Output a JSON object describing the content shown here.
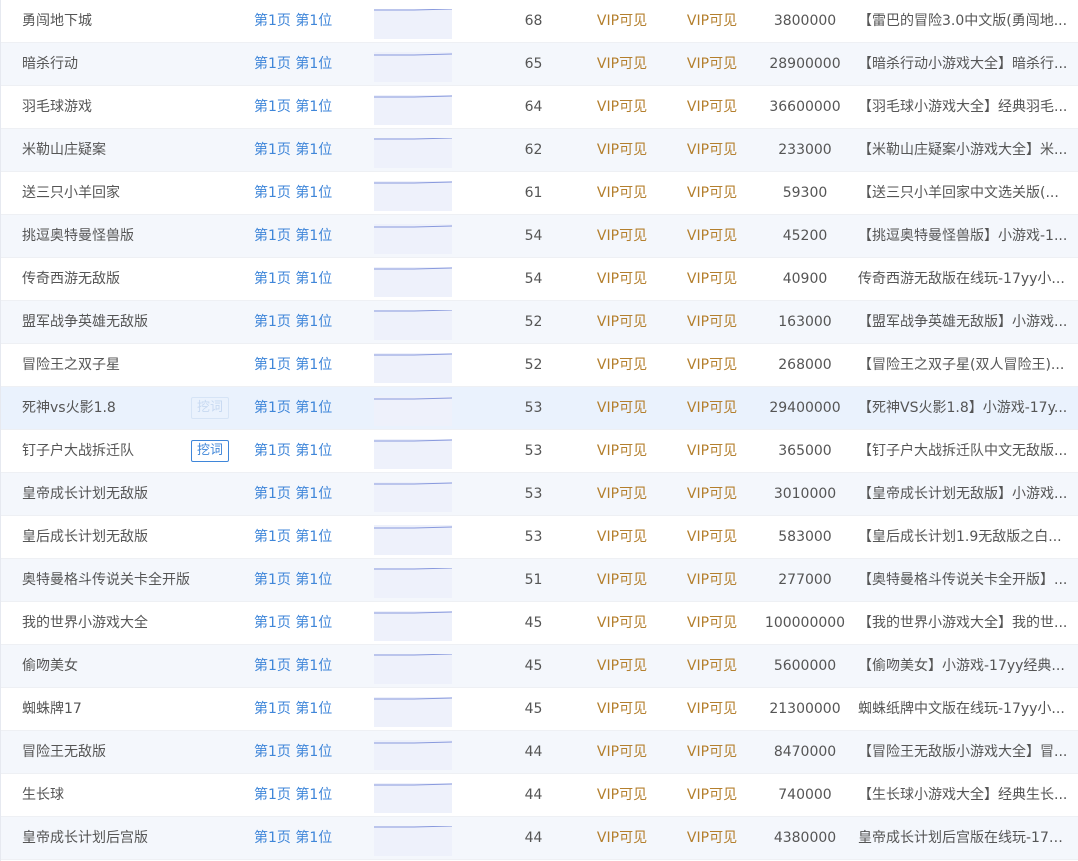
{
  "dig_label": "挖词",
  "rows": [
    {
      "keyword": "勇闯地下城",
      "rank": "第1页 第1位",
      "index": "68",
      "vip_a": "VIP可见",
      "vip_b": "VIP可见",
      "results": "3800000",
      "title": "【雷巴的冒险3.0中文版(勇闯地..."
    },
    {
      "keyword": "暗杀行动",
      "rank": "第1页 第1位",
      "index": "65",
      "vip_a": "VIP可见",
      "vip_b": "VIP可见",
      "results": "28900000",
      "title": "【暗杀行动小游戏大全】暗杀行..."
    },
    {
      "keyword": "羽毛球游戏",
      "rank": "第1页 第1位",
      "index": "64",
      "vip_a": "VIP可见",
      "vip_b": "VIP可见",
      "results": "36600000",
      "title": "【羽毛球小游戏大全】经典羽毛..."
    },
    {
      "keyword": "米勒山庄疑案",
      "rank": "第1页 第1位",
      "index": "62",
      "vip_a": "VIP可见",
      "vip_b": "VIP可见",
      "results": "233000",
      "title": "【米勒山庄疑案小游戏大全】米..."
    },
    {
      "keyword": "送三只小羊回家",
      "rank": "第1页 第1位",
      "index": "61",
      "vip_a": "VIP可见",
      "vip_b": "VIP可见",
      "results": "59300",
      "title": "【送三只小羊回家中文选关版(..."
    },
    {
      "keyword": "挑逗奥特曼怪兽版",
      "rank": "第1页 第1位",
      "index": "54",
      "vip_a": "VIP可见",
      "vip_b": "VIP可见",
      "results": "45200",
      "title": "【挑逗奥特曼怪兽版】小游戏-1..."
    },
    {
      "keyword": "传奇西游无敌版",
      "rank": "第1页 第1位",
      "index": "54",
      "vip_a": "VIP可见",
      "vip_b": "VIP可见",
      "results": "40900",
      "title": "传奇西游无敌版在线玩-17yy小..."
    },
    {
      "keyword": "盟军战争英雄无敌版",
      "rank": "第1页 第1位",
      "index": "52",
      "vip_a": "VIP可见",
      "vip_b": "VIP可见",
      "results": "163000",
      "title": "【盟军战争英雄无敌版】小游戏..."
    },
    {
      "keyword": "冒险王之双子星",
      "rank": "第1页 第1位",
      "index": "52",
      "vip_a": "VIP可见",
      "vip_b": "VIP可见",
      "results": "268000",
      "title": "【冒险王之双子星(双人冒险王)..."
    },
    {
      "keyword": "死神vs火影1.8",
      "rank": "第1页 第1位",
      "index": "53",
      "vip_a": "VIP可见",
      "vip_b": "VIP可见",
      "results": "29400000",
      "title": "【死神VS火影1.8】小游戏-17y..."
    },
    {
      "keyword": "钉子户大战拆迁队",
      "rank": "第1页 第1位",
      "index": "53",
      "vip_a": "VIP可见",
      "vip_b": "VIP可见",
      "results": "365000",
      "title": "【钉子户大战拆迁队中文无敌版..."
    },
    {
      "keyword": "皇帝成长计划无敌版",
      "rank": "第1页 第1位",
      "index": "53",
      "vip_a": "VIP可见",
      "vip_b": "VIP可见",
      "results": "3010000",
      "title": "【皇帝成长计划无敌版】小游戏..."
    },
    {
      "keyword": "皇后成长计划无敌版",
      "rank": "第1页 第1位",
      "index": "53",
      "vip_a": "VIP可见",
      "vip_b": "VIP可见",
      "results": "583000",
      "title": "【皇后成长计划1.9无敌版之白..."
    },
    {
      "keyword": "奥特曼格斗传说关卡全开版",
      "rank": "第1页 第1位",
      "index": "51",
      "vip_a": "VIP可见",
      "vip_b": "VIP可见",
      "results": "277000",
      "title": "【奥特曼格斗传说关卡全开版】..."
    },
    {
      "keyword": "我的世界小游戏大全",
      "rank": "第1页 第1位",
      "index": "45",
      "vip_a": "VIP可见",
      "vip_b": "VIP可见",
      "results": "100000000",
      "title": "【我的世界小游戏大全】我的世..."
    },
    {
      "keyword": "偷吻美女",
      "rank": "第1页 第1位",
      "index": "45",
      "vip_a": "VIP可见",
      "vip_b": "VIP可见",
      "results": "5600000",
      "title": "【偷吻美女】小游戏-17yy经典..."
    },
    {
      "keyword": "蜘蛛牌17",
      "rank": "第1页 第1位",
      "index": "45",
      "vip_a": "VIP可见",
      "vip_b": "VIP可见",
      "results": "21300000",
      "title": "蜘蛛纸牌中文版在线玩-17yy小..."
    },
    {
      "keyword": "冒险王无敌版",
      "rank": "第1页 第1位",
      "index": "44",
      "vip_a": "VIP可见",
      "vip_b": "VIP可见",
      "results": "8470000",
      "title": "【冒险王无敌版小游戏大全】冒..."
    },
    {
      "keyword": "生长球",
      "rank": "第1页 第1位",
      "index": "44",
      "vip_a": "VIP可见",
      "vip_b": "VIP可见",
      "results": "740000",
      "title": "【生长球小游戏大全】经典生长..."
    },
    {
      "keyword": "皇帝成长计划后宫版",
      "rank": "第1页 第1位",
      "index": "44",
      "vip_a": "VIP可见",
      "vip_b": "VIP可见",
      "results": "4380000",
      "title": "皇帝成长计划后宫版在线玩-17y..."
    }
  ]
}
